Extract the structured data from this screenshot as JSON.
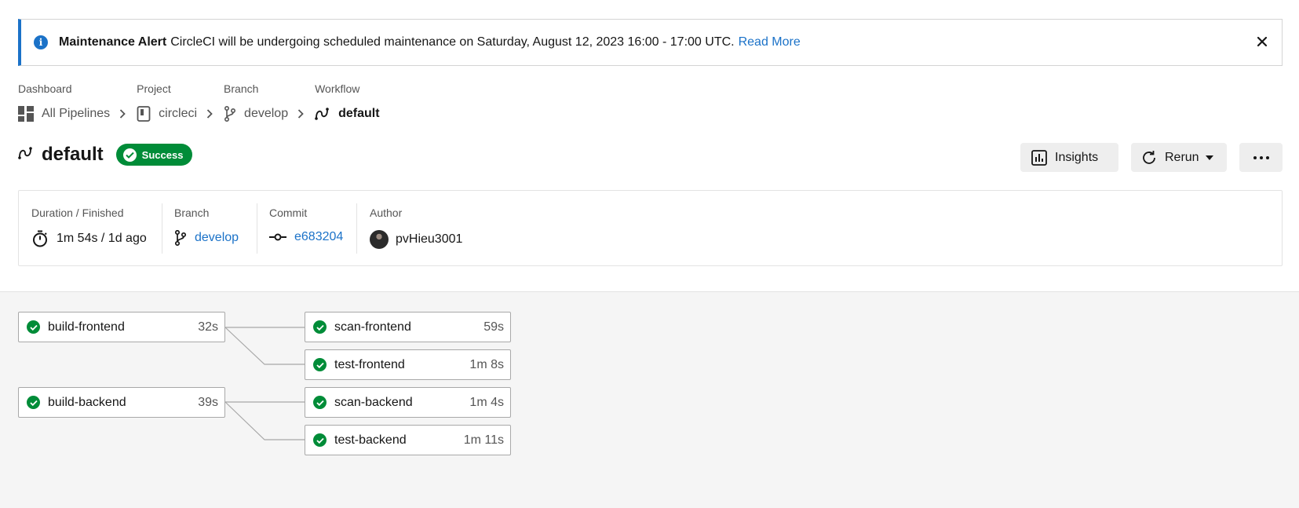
{
  "alert": {
    "title": "Maintenance Alert",
    "message": "CircleCI will be undergoing scheduled maintenance on Saturday, August 12, 2023 16:00 - 17:00 UTC.",
    "link": "Read More"
  },
  "breadcrumbs": [
    {
      "label": "Dashboard",
      "value": "All Pipelines"
    },
    {
      "label": "Project",
      "value": "circleci"
    },
    {
      "label": "Branch",
      "value": "develop"
    },
    {
      "label": "Workflow",
      "value": "default"
    }
  ],
  "workflow": {
    "name": "default",
    "status": "Success"
  },
  "actions": {
    "insights": "Insights",
    "rerun": "Rerun"
  },
  "details": {
    "duration_label": "Duration / Finished",
    "duration_value": "1m 54s / 1d ago",
    "branch_label": "Branch",
    "branch_value": "develop",
    "commit_label": "Commit",
    "commit_value": "e683204",
    "author_label": "Author",
    "author_value": "pvHieu3001"
  },
  "jobs": [
    {
      "name": "build-frontend",
      "duration": "32s",
      "status": "success"
    },
    {
      "name": "scan-frontend",
      "duration": "59s",
      "status": "success"
    },
    {
      "name": "test-frontend",
      "duration": "1m 8s",
      "status": "success"
    },
    {
      "name": "build-backend",
      "duration": "39s",
      "status": "success"
    },
    {
      "name": "scan-backend",
      "duration": "1m 4s",
      "status": "success"
    },
    {
      "name": "test-backend",
      "duration": "1m 11s",
      "status": "success"
    }
  ],
  "colors": {
    "accent": "#1b72c8",
    "success": "#008c38"
  }
}
